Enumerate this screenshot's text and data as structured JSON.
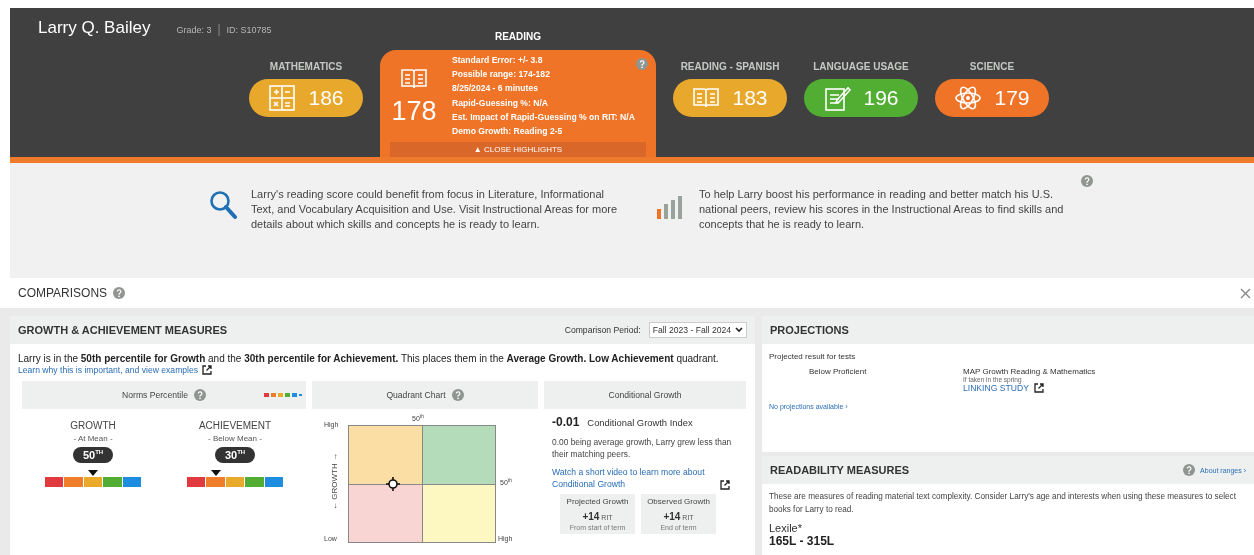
{
  "student": {
    "name": "Larry Q. Bailey",
    "grade": "Grade: 3",
    "separator": "|",
    "id": "ID: S10785"
  },
  "subjects": [
    {
      "label": "MATHEMATICS",
      "score": "186",
      "color": "#e8a82c",
      "selected": false
    },
    {
      "label": "READING",
      "score": "178",
      "color": "#ef7428",
      "selected": true,
      "details": [
        "Standard Error: +/- 3.8",
        "Possible range: 174-182",
        "8/25/2024 - 6 minutes",
        "Rapid-Guessing %: N/A",
        "Est. Impact of Rapid-Guessing % on RIT: N/A",
        "Demo Growth: Reading 2-5"
      ],
      "close_label": "▲ CLOSE HIGHLIGHTS"
    },
    {
      "label": "READING - SPANISH",
      "score": "183",
      "color": "#e8a82c",
      "selected": false
    },
    {
      "label": "LANGUAGE USAGE",
      "score": "196",
      "color": "#52ae32",
      "selected": false
    },
    {
      "label": "SCIENCE",
      "score": "179",
      "color": "#ef7428",
      "selected": false
    }
  ],
  "insights": [
    {
      "text": "Larry's reading score could benefit from focus in Literature, Informational Text, and Vocabulary Acquisition and Use. Visit Instructional Areas for more details about which skills and concepts he is ready to learn."
    },
    {
      "text": "To help Larry boost his performance in reading and better match his U.S. national peers, review his scores in the Instructional Areas to find skills and concepts that he is ready to learn."
    }
  ],
  "comparisons": {
    "title": "COMPARISONS"
  },
  "growth": {
    "title": "GROWTH & ACHIEVEMENT MEASURES",
    "period_label": "Comparison Period:",
    "period_value": "Fall 2023 - Fall 2024",
    "summary": "Larry is in the **50th percentile for Growth** and the **30th percentile for Achievement.** This places them in the **Average Growth. Low Achievement** quadrant.",
    "learn_link": "Learn why this is important, and view examples",
    "norms": {
      "title": "Norms Percentile",
      "items": [
        {
          "label": "GROWTH",
          "status": "- At Mean -",
          "percentile": "50$^{TH}$",
          "level": 0.5
        },
        {
          "label": "ACHIEVEMENT",
          "status": "- Below Mean -",
          "percentile": "30$^{TH}$",
          "level": 0.3
        }
      ]
    },
    "quadrant": {
      "title": "Quadrant Chart",
      "top_label": "50$^{th}$",
      "right_label": "50$^{th}$",
      "y_high": "High",
      "y_low": "Low",
      "x_high": "High",
      "y_axis": "← GROWTH →"
    },
    "conditional": {
      "title": "Conditional Growth",
      "index_value": "-0.01",
      "index_label": "Conditional Growth Index",
      "note": "0.00 being average growth, Larry grew less than their matching peers.",
      "video_link": "Watch a short video to learn more about Conditional Growth",
      "boxes": [
        {
          "title": "Projected Growth",
          "value": "+14",
          "unit": "RIT",
          "note": "From start of term"
        },
        {
          "title": "Observed Growth",
          "value": "+14",
          "unit": "RIT",
          "note": "End of term"
        }
      ]
    }
  },
  "projections": {
    "title": "PROJECTIONS",
    "subtitle": "Projected result for tests",
    "result": "Below Proficient",
    "test_name": "MAP Growth Reading & Mathematics",
    "test_note": "If taken in the spring",
    "link": "LINKING STUDY",
    "none_link": "No projections available ›"
  },
  "readability": {
    "title": "READABILITY MEASURES",
    "about_link": "About ranges ›",
    "description": "These are measures of reading material text complexity. Consider Larry's age and interests when using these measures to select books for Larry to read.",
    "measure_label": "Lexile*",
    "measure_value": "165L - 315L"
  }
}
